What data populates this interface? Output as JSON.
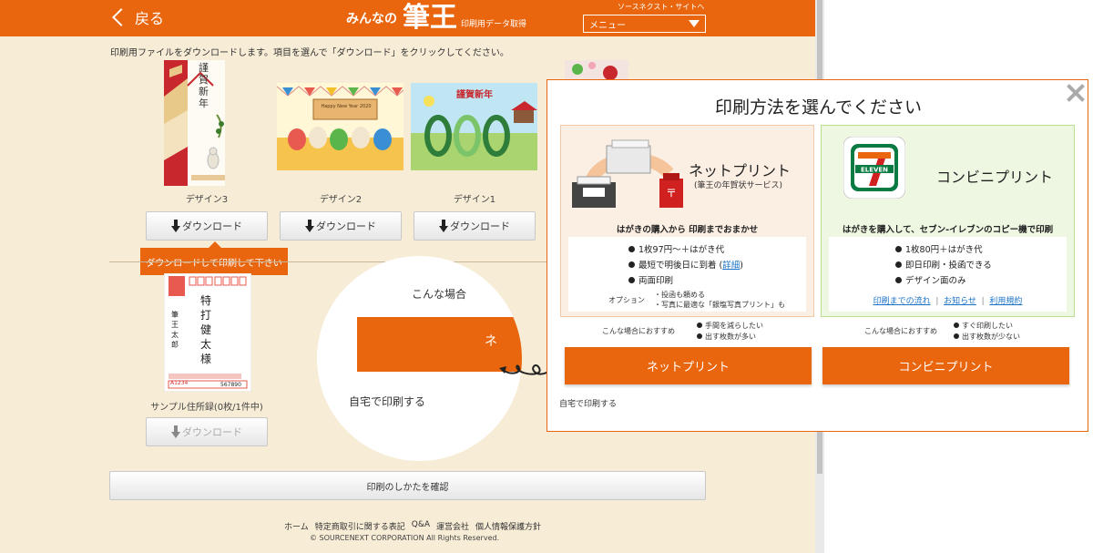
{
  "header": {
    "back_label": "戻る",
    "logo_prefix": "みんなの",
    "logo_main": "筆王",
    "logo_suffix": "印刷用データ取得",
    "sourcenext_link": "ソースネクスト・サイトへ",
    "menu_label": "メニュー"
  },
  "instruction": "印刷用ファイルをダウンロードします。項目を選んで「ダウンロード」をクリックしてください。",
  "designs": [
    {
      "label": "デザイン3"
    },
    {
      "label": "デザイン2"
    },
    {
      "label": "デザイン1"
    }
  ],
  "download_label": "ダウンロード",
  "design1_banner": "謹賀新年",
  "design2_banner": "Happy New Year 2020",
  "design3_banner": "謹賀新年",
  "tooltip": "ダウンロードして印刷して下さい",
  "address_sample": {
    "label": "サンプル住所録(0枚/1件中)",
    "recipient": "特打健太様",
    "sender": "筆王太郎",
    "postal_code": "567890",
    "sender_code": "A1234"
  },
  "spotlight": {
    "text1": "こんな場合",
    "orange_text": "ネ",
    "text2": "自宅で印刷する"
  },
  "confirm_button": "印刷のしかたを確認",
  "footer": {
    "links": [
      "ホーム",
      "特定商取引に関する表記",
      "Q&A",
      "運営会社",
      "個人情報保護方針"
    ],
    "copyright": "© SOURCENEXT CORPORATION All Rights Reserved."
  },
  "modal": {
    "title": "印刷方法を選んでください",
    "net": {
      "title": "ネットプリント",
      "subtitle": "(筆王の年賀状サービス)",
      "headline": "はがきの購入から 印刷までおまかせ",
      "features": [
        "1枚97円～＋はがき代",
        "最短で明後日に到着",
        "両面印刷"
      ],
      "detail_link": "詳細",
      "option_label": "オプション",
      "options": [
        "・投函も頼める",
        "・写真に最適な「銀塩写真プリント」も"
      ],
      "rec_label": "こんな場合におすすめ",
      "rec_items": [
        "手間を減らしたい",
        "出す枚数が多い"
      ],
      "button": "ネットプリント"
    },
    "cvs": {
      "title": "コンビニプリント",
      "logo_text": "ELEVEN",
      "headline": "はがきを購入して、セブン‐イレブンのコピー機で印刷",
      "features": [
        "1枚80円＋はがき代",
        "即日印刷・投函できる",
        "デザイン面のみ"
      ],
      "links": [
        "印刷までの流れ",
        "お知らせ",
        "利用規約"
      ],
      "rec_label": "こんな場合におすすめ",
      "rec_items": [
        "すぐ印刷したい",
        "出す枚数が少ない"
      ],
      "button": "コンビニプリント"
    },
    "home_print": "自宅で印刷する"
  },
  "colors": {
    "brand_orange": "#e9660e",
    "background": "#f7ecd6",
    "link_blue": "#1a73c7"
  }
}
